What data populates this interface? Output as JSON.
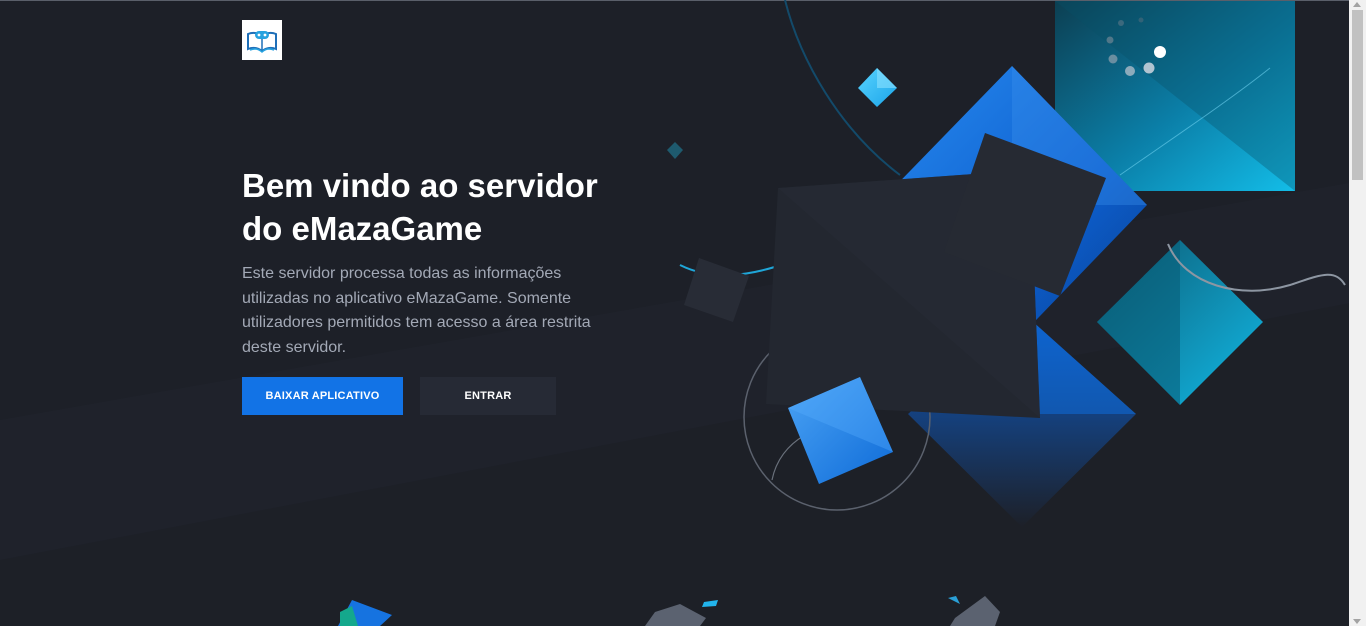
{
  "brand": {
    "logo_icon": "open-book-gamepad-icon",
    "logo_alt": "eMazaGame"
  },
  "hero": {
    "title_line1": "Bem vindo ao servidor",
    "title_line2": "do eMazaGame",
    "description": "Este servidor processa todas as informações utilizadas no aplicativo eMazaGame. Somente utilizadores permitidos tem acesso a área restrita deste servidor."
  },
  "actions": {
    "download_label": "BAIXAR APLICATIVO",
    "login_label": "ENTRAR"
  },
  "colors": {
    "background": "#1d2028",
    "primary_button": "#1273e6",
    "secondary_button": "#262a35",
    "accent_blue": "#0e6bd8",
    "accent_cyan": "#13b8e8"
  }
}
